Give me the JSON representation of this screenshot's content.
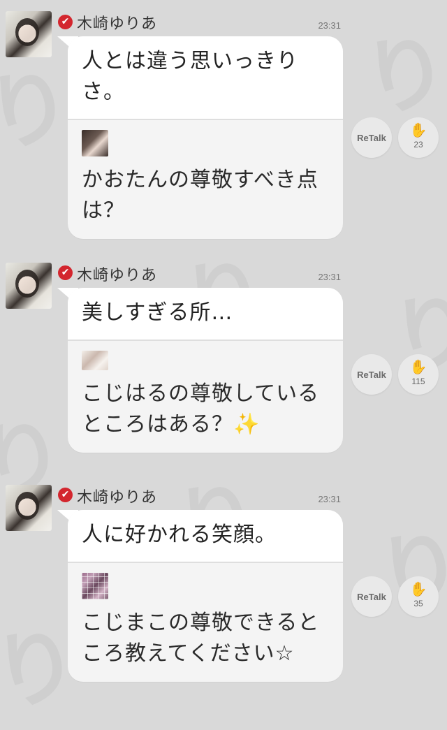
{
  "posts": [
    {
      "author": "木崎ゆりあ",
      "badge": "✔",
      "time": "23:31",
      "answer": "人とは違う思いっきりさ。",
      "question": "かおたんの尊敬すべき点は？",
      "retalk_label": "ReTalk",
      "clap_count": "23"
    },
    {
      "author": "木崎ゆりあ",
      "badge": "✔",
      "time": "23:31",
      "answer": "美しすぎる所…",
      "question": "こじはるの尊敬しているところはある？",
      "question_emoji": "✨",
      "retalk_label": "ReTalk",
      "clap_count": "115"
    },
    {
      "author": "木崎ゆりあ",
      "badge": "✔",
      "time": "23:31",
      "answer": "人に好かれる笑顔。",
      "question": "こじまこの尊敬できるところ教えてください☆",
      "retalk_label": "ReTalk",
      "clap_count": "35"
    }
  ],
  "icons": {
    "verified": "verified-check-icon",
    "clap": "clap-hands-icon"
  },
  "colors": {
    "background": "#d9d9d9",
    "badge": "#d3262e",
    "answer_bg": "#ffffff",
    "question_bg": "#f4f4f4"
  }
}
